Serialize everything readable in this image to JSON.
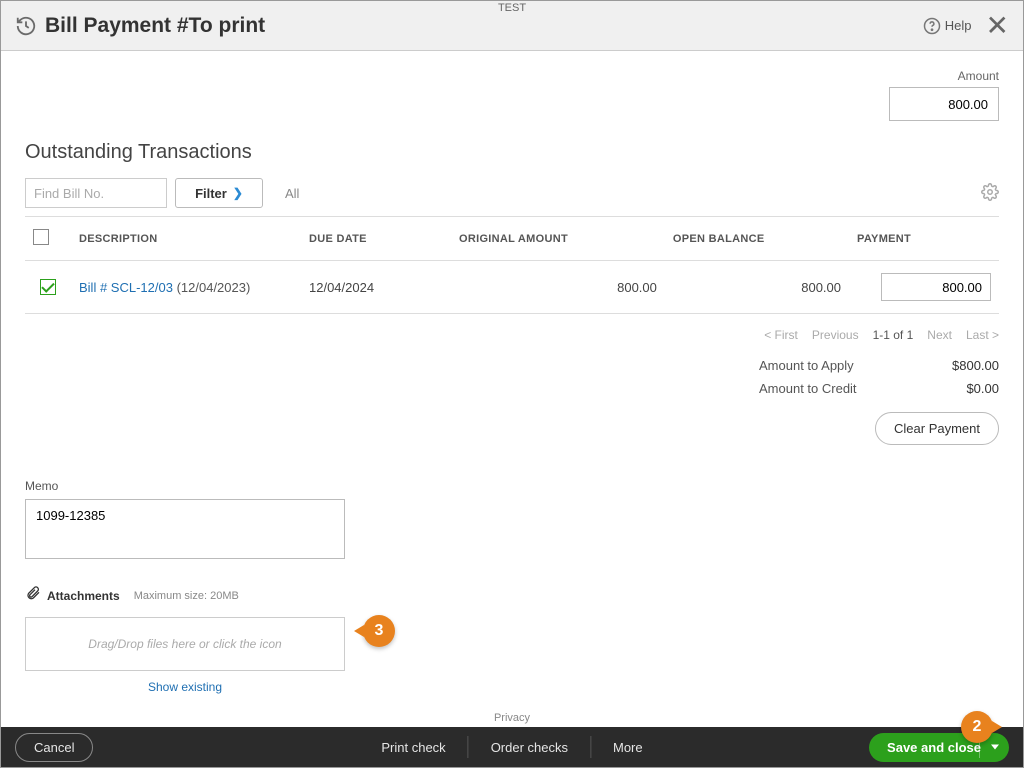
{
  "header": {
    "title": "Bill Payment #To print",
    "badge": "TEST",
    "help": "Help"
  },
  "amount": {
    "label": "Amount",
    "value": "800.00"
  },
  "outstanding": {
    "title": "Outstanding Transactions",
    "find_placeholder": "Find Bill No.",
    "filter_label": "Filter",
    "filter_scope": "All",
    "columns": {
      "description": "DESCRIPTION",
      "due": "DUE DATE",
      "original": "ORIGINAL AMOUNT",
      "open": "OPEN BALANCE",
      "payment": "PAYMENT"
    },
    "rows": [
      {
        "checked": true,
        "bill_link": "Bill # SCL-12/03",
        "bill_paren": "(12/04/2023)",
        "due": "12/04/2024",
        "original": "800.00",
        "open": "800.00",
        "payment": "800.00"
      }
    ],
    "pager": {
      "first": "< First",
      "prev": "Previous",
      "range": "1-1 of 1",
      "next": "Next",
      "last": "Last >"
    }
  },
  "summary": {
    "apply_label": "Amount to Apply",
    "apply_value": "$800.00",
    "credit_label": "Amount to Credit",
    "credit_value": "$0.00",
    "clear": "Clear Payment"
  },
  "memo": {
    "label": "Memo",
    "value": "1099-12385"
  },
  "attachments": {
    "label": "Attachments",
    "max": "Maximum size: 20MB",
    "drop_hint": "Drag/Drop files here or click the icon",
    "show_existing": "Show existing"
  },
  "privacy": "Privacy",
  "footer": {
    "cancel": "Cancel",
    "print": "Print check",
    "order": "Order checks",
    "more": "More",
    "save": "Save and close"
  },
  "callouts": {
    "c2": "2",
    "c3": "3"
  }
}
